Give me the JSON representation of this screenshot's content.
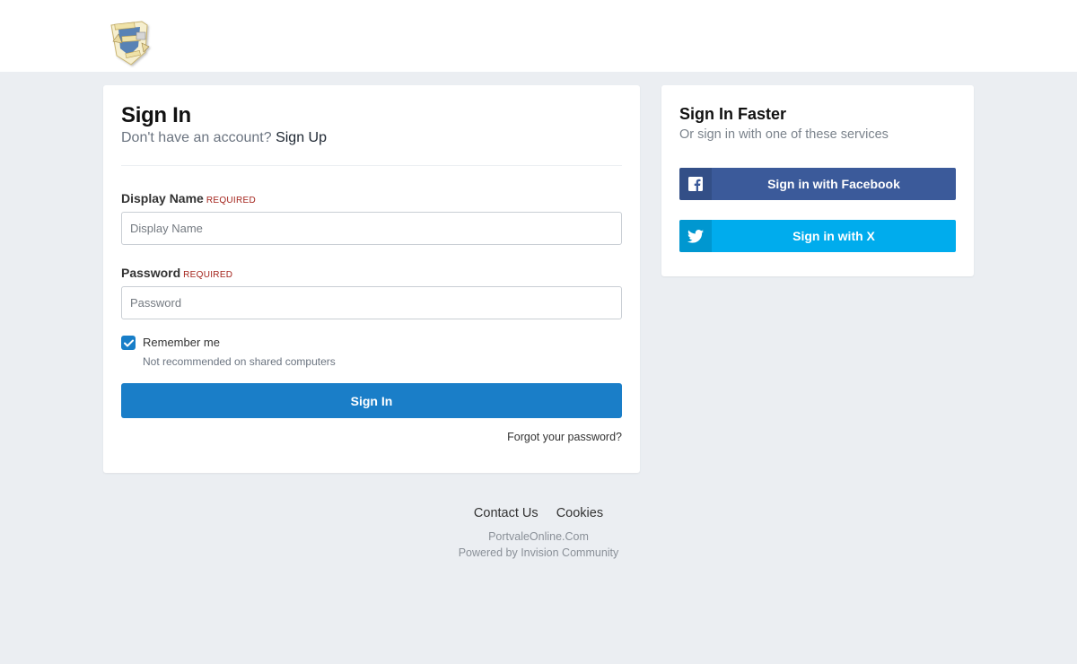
{
  "signin": {
    "title": "Sign In",
    "no_account": "Don't have an account?",
    "signup_link": "Sign Up",
    "display_name": {
      "label": "Display Name",
      "required": "REQUIRED",
      "placeholder": "Display Name",
      "value": ""
    },
    "password": {
      "label": "Password",
      "required": "REQUIRED",
      "placeholder": "Password",
      "value": ""
    },
    "remember": {
      "label": "Remember me",
      "note": "Not recommended on shared computers",
      "checked": true
    },
    "submit_label": "Sign In",
    "forgot_label": "Forgot your password?"
  },
  "faster": {
    "title": "Sign In Faster",
    "subtitle": "Or sign in with one of these services",
    "facebook_label": "Sign in with Facebook",
    "x_label": "Sign in with X"
  },
  "footer": {
    "links": [
      "Contact Us",
      "Cookies"
    ],
    "site": "PortvaleOnline.Com",
    "powered": "Powered by Invision Community"
  },
  "colors": {
    "primary": "#1a7ec8",
    "facebook": "#3b5a9a",
    "x": "#00aced",
    "required": "#a3221a",
    "background": "#ebeef2"
  }
}
